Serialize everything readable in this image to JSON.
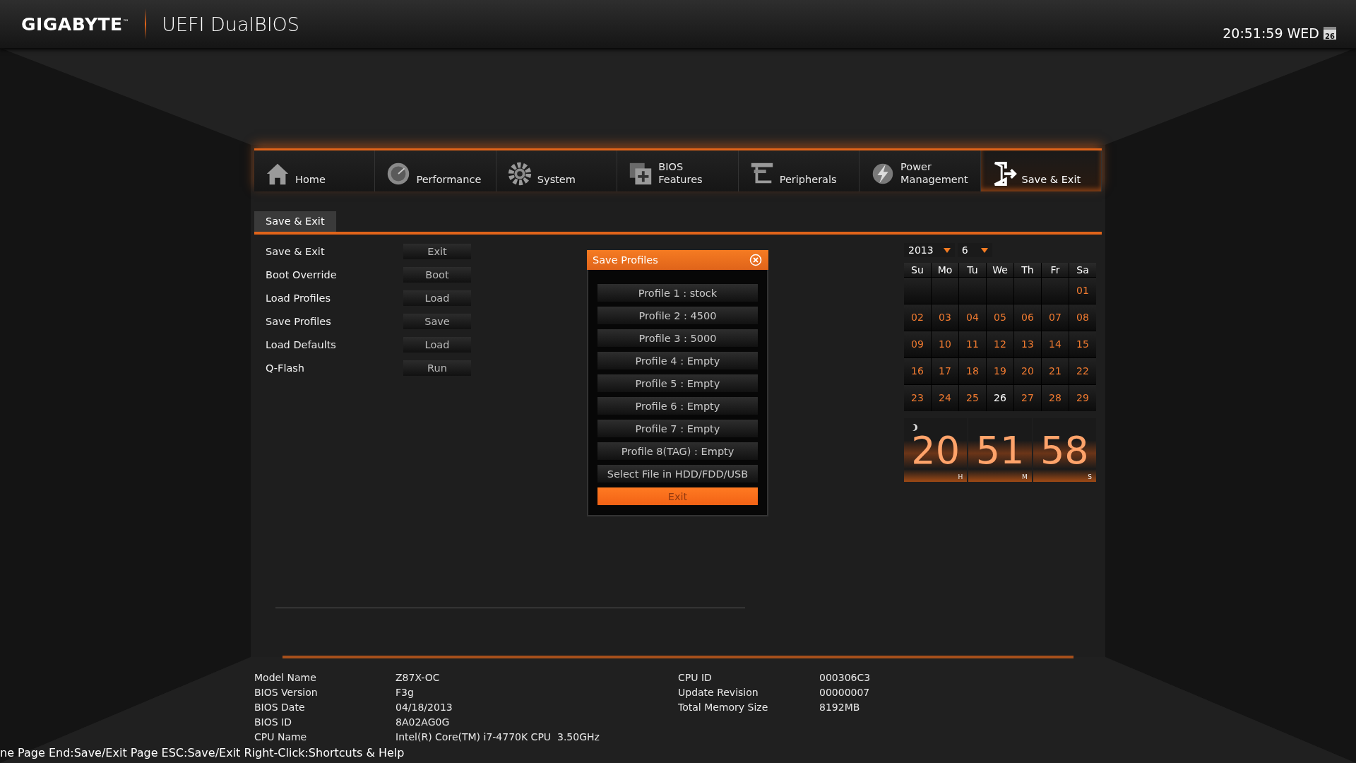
{
  "header": {
    "brand": "GIGABYTE",
    "trademark": "™",
    "title": "UEFI DualBIOS",
    "clock": "20:51:59 WED",
    "calendar_day": "26"
  },
  "tabs": [
    {
      "label": "Home",
      "selected": false
    },
    {
      "label": "Performance",
      "selected": false
    },
    {
      "label": "System",
      "selected": false
    },
    {
      "label": "BIOS\nFeatures",
      "selected": false
    },
    {
      "label": "Peripherals",
      "selected": false
    },
    {
      "label": "Power\nManagement",
      "selected": false
    },
    {
      "label": "Save & Exit",
      "selected": true
    }
  ],
  "subtab": {
    "label": "Save & Exit",
    "selected": true
  },
  "items": [
    {
      "label": "Save & Exit",
      "action": "Exit"
    },
    {
      "label": "Boot Override",
      "action": "Boot"
    },
    {
      "label": "Load Profiles",
      "action": "Load"
    },
    {
      "label": "Save Profiles",
      "action": "Save"
    },
    {
      "label": "Load Defaults",
      "action": "Load"
    },
    {
      "label": "Q-Flash",
      "action": "Run"
    }
  ],
  "dialog": {
    "title": "Save Profiles",
    "options": [
      {
        "label": "Profile 1 : stock",
        "kind": "option"
      },
      {
        "label": "Profile 2 : 4500",
        "kind": "option"
      },
      {
        "label": "Profile 3 : 5000",
        "kind": "option"
      },
      {
        "label": "Profile 4 : Empty",
        "kind": "option"
      },
      {
        "label": "Profile 5 : Empty",
        "kind": "option"
      },
      {
        "label": "Profile 6 : Empty",
        "kind": "option"
      },
      {
        "label": "Profile 7 : Empty",
        "kind": "option"
      },
      {
        "label": "Profile 8(TAG) : Empty",
        "kind": "option"
      },
      {
        "label": "Select File in HDD/FDD/USB",
        "kind": "option"
      },
      {
        "label": "Exit",
        "kind": "exit"
      }
    ]
  },
  "calendar": {
    "year": "2013",
    "month": "6",
    "weekdays": [
      "Su",
      "Mo",
      "Tu",
      "We",
      "Th",
      "Fr",
      "Sa"
    ],
    "weeks": [
      [
        {
          "kind": "blank"
        },
        {
          "kind": "blank"
        },
        {
          "kind": "blank"
        },
        {
          "kind": "blank"
        },
        {
          "kind": "blank"
        },
        {
          "kind": "blank"
        },
        {
          "kind": "day",
          "day": "01",
          "selected": false
        }
      ],
      [
        {
          "kind": "day",
          "day": "02",
          "selected": false
        },
        {
          "kind": "day",
          "day": "03",
          "selected": false
        },
        {
          "kind": "day",
          "day": "04",
          "selected": false
        },
        {
          "kind": "day",
          "day": "05",
          "selected": false
        },
        {
          "kind": "day",
          "day": "06",
          "selected": false
        },
        {
          "kind": "day",
          "day": "07",
          "selected": false
        },
        {
          "kind": "day",
          "day": "08",
          "selected": false
        }
      ],
      [
        {
          "kind": "day",
          "day": "09",
          "selected": false
        },
        {
          "kind": "day",
          "day": "10",
          "selected": false
        },
        {
          "kind": "day",
          "day": "11",
          "selected": false
        },
        {
          "kind": "day",
          "day": "12",
          "selected": false
        },
        {
          "kind": "day",
          "day": "13",
          "selected": false
        },
        {
          "kind": "day",
          "day": "14",
          "selected": false
        },
        {
          "kind": "day",
          "day": "15",
          "selected": false
        }
      ],
      [
        {
          "kind": "day",
          "day": "16",
          "selected": false
        },
        {
          "kind": "day",
          "day": "17",
          "selected": false
        },
        {
          "kind": "day",
          "day": "18",
          "selected": false
        },
        {
          "kind": "day",
          "day": "19",
          "selected": false
        },
        {
          "kind": "day",
          "day": "20",
          "selected": false
        },
        {
          "kind": "day",
          "day": "21",
          "selected": false
        },
        {
          "kind": "day",
          "day": "22",
          "selected": false
        }
      ],
      [
        {
          "kind": "day",
          "day": "23",
          "selected": false
        },
        {
          "kind": "day",
          "day": "24",
          "selected": false
        },
        {
          "kind": "day",
          "day": "25",
          "selected": false
        },
        {
          "kind": "day",
          "day": "26",
          "selected": true
        },
        {
          "kind": "day",
          "day": "27",
          "selected": false
        },
        {
          "kind": "day",
          "day": "28",
          "selected": false
        },
        {
          "kind": "day",
          "day": "29",
          "selected": false
        }
      ]
    ]
  },
  "flip_clock": [
    {
      "value": "20",
      "unit": "H"
    },
    {
      "value": "51",
      "unit": "M"
    },
    {
      "value": "58",
      "unit": "S"
    }
  ],
  "info_left": [
    {
      "label": "Model Name",
      "value": "Z87X-OC"
    },
    {
      "label": "BIOS Version",
      "value": "F3g"
    },
    {
      "label": "BIOS Date",
      "value": "04/18/2013"
    },
    {
      "label": "BIOS ID",
      "value": "8A02AG0G"
    },
    {
      "label": "CPU Name",
      "value": "Intel(R) Core(TM) i7-4770K CPU  3.50GHz"
    }
  ],
  "info_right": [
    {
      "label": "CPU ID",
      "value": "000306C3"
    },
    {
      "label": "Update Revision",
      "value": "00000007"
    },
    {
      "label": "Total Memory Size",
      "value": "8192MB"
    }
  ],
  "status_bar": "ne Page End:Save/Exit Page ESC:Save/Exit Right-Click:Shortcuts & Help"
}
